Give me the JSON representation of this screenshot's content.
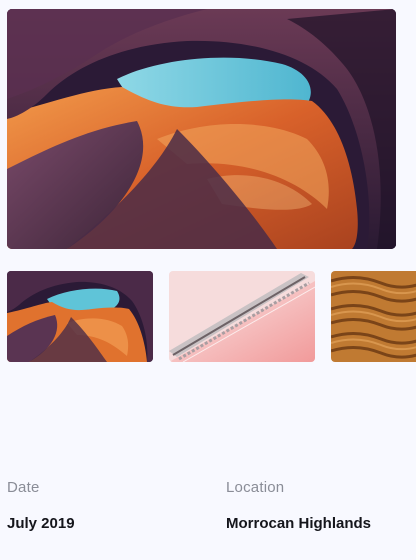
{
  "gallery": {
    "main_image": {
      "subject": "canyon-arch-photo",
      "colors": {
        "sky": "#5fc4d8",
        "rock_warm": "#e0722e",
        "rock_dark": "#3b2440"
      }
    },
    "thumbnails": [
      {
        "subject": "canyon-arch-photo",
        "selected": true
      },
      {
        "subject": "pink-wall-staircase-photo"
      },
      {
        "subject": "desert-sand-ripples-photo"
      }
    ]
  },
  "details": {
    "date_label": "Date",
    "date_value": "July 2019",
    "location_label": "Location",
    "location_value": "Morrocan Highlands"
  }
}
